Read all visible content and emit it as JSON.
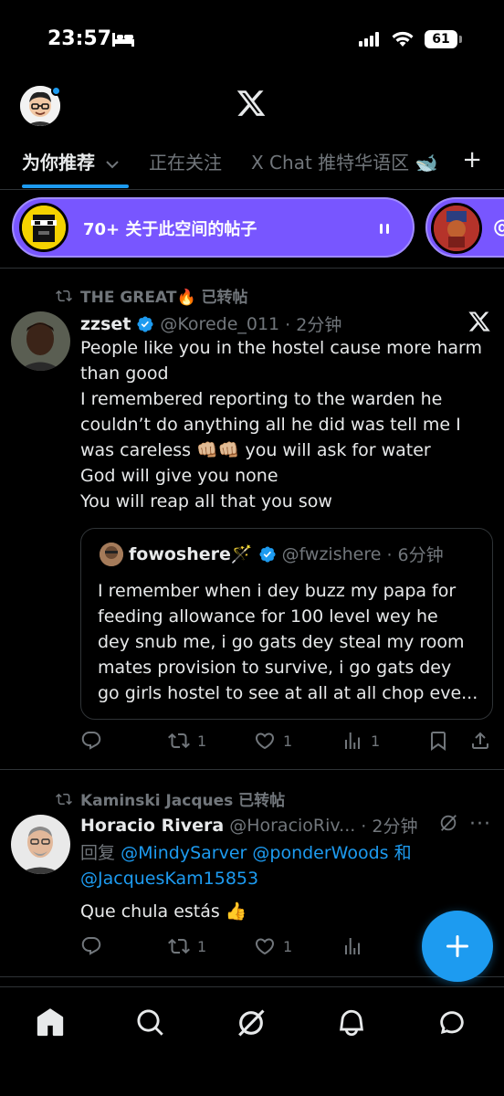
{
  "status_bar": {
    "time": "23:57",
    "battery": "61"
  },
  "tabs": {
    "items": [
      {
        "label": "为你推荐",
        "active": true
      },
      {
        "label": "正在关注",
        "active": false
      },
      {
        "label": "X Chat 推特华语区 🐋",
        "active": false
      }
    ],
    "add_symbol": "+"
  },
  "spaces": {
    "primary_label": "70+ 关于此空间的帖子",
    "secondary_label": "@"
  },
  "posts": [
    {
      "repost_by": "THE GREAT🔥 已转帖",
      "name": "zzset",
      "handle": "@Korede_011",
      "time": "· 2分钟",
      "lines": [
        "People like you in the hostel cause more harm",
        "than good",
        "I remembered reporting to the warden he",
        "couldn’t do anything all he  did was tell me I",
        "was careless 👊🏼👊🏼 you will ask for water",
        "God will give you none",
        "You will reap all that you sow"
      ],
      "quote": {
        "name": "fowoshere🪄",
        "handle": "@fwzishere",
        "time": "· 6分钟",
        "lines": [
          "I remember when i dey buzz my papa for",
          "feeding allowance for 100 level wey he",
          "dey snub me, i go gats dey steal my room",
          "mates provision to survive, i go gats dey",
          "go girls hostel to see at all at all chop eve..."
        ]
      },
      "replies": "",
      "reposts": "1",
      "likes": "1",
      "views": "1"
    },
    {
      "repost_by": "Kaminski Jacques 已转帖",
      "name": "Horacio Rivera",
      "handle": "@HoracioRiv...",
      "time": "· 2分钟",
      "reply_prefix": "回复",
      "reply_to_1": "@MindySarver @ponderWoods 和",
      "reply_to_2": "@JacquesKam15853",
      "text": "Que chula estás 👍",
      "replies": "",
      "reposts": "1",
      "likes": "1",
      "views": "",
      "more": "···"
    }
  ],
  "fab_symbol": "+",
  "colors": {
    "accent": "#1d9bf0",
    "spaces": "#7856ff",
    "muted": "#71767b",
    "background": "#000000"
  }
}
